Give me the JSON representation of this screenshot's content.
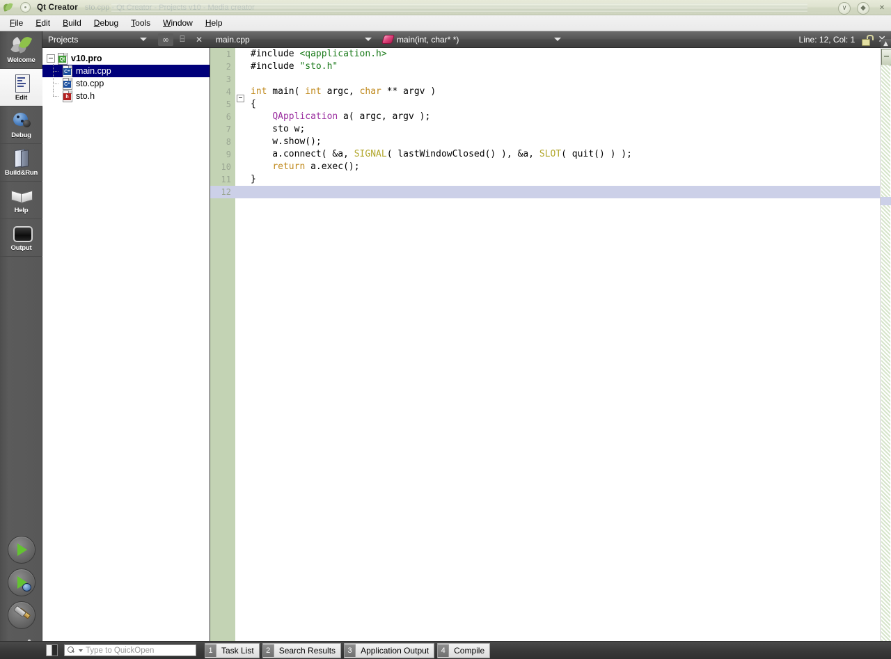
{
  "window": {
    "app_icon": "qt-leaf-icon",
    "title": "Qt Creator",
    "ghost_title": "sto.cpp - Qt Creator - Projects v10 - Media creator",
    "buttons": [
      {
        "name": "minimize",
        "glyph": "∨"
      },
      {
        "name": "maximize",
        "glyph": "◆"
      },
      {
        "name": "close",
        "glyph": "✕"
      }
    ]
  },
  "menubar": {
    "items": [
      {
        "name": "file",
        "accel": "F",
        "rest": "ile"
      },
      {
        "name": "edit",
        "accel": "E",
        "rest": "dit"
      },
      {
        "name": "build",
        "accel": "B",
        "rest": "uild"
      },
      {
        "name": "debug",
        "accel": "D",
        "rest": "ebug"
      },
      {
        "name": "tools",
        "accel": "T",
        "rest": "ools"
      },
      {
        "name": "window",
        "accel": "W",
        "rest": "indow"
      },
      {
        "name": "help",
        "accel": "H",
        "rest": "elp"
      }
    ]
  },
  "modebar": {
    "items": [
      {
        "label": "Welcome",
        "icon": "welcome-leaves-icon",
        "active": false
      },
      {
        "label": "Edit",
        "icon": "edit-document-icon",
        "active": true
      },
      {
        "label": "Debug",
        "icon": "debug-bug-icon",
        "active": false
      },
      {
        "label": "Build&Run",
        "icon": "build-book-icon",
        "active": false
      },
      {
        "label": "Help",
        "icon": "help-book-icon",
        "active": false
      },
      {
        "label": "Output",
        "icon": "output-screen-icon",
        "active": false
      }
    ],
    "run_buttons": [
      {
        "name": "run-button",
        "icon": "play-icon"
      },
      {
        "name": "debug-button",
        "icon": "play-with-bug-icon"
      },
      {
        "name": "build-button",
        "icon": "hammer-icon"
      }
    ]
  },
  "sidebar": {
    "title": "Projects",
    "header_icons": [
      {
        "name": "sync-link-icon",
        "glyph": "∞"
      },
      {
        "name": "split-view-icon",
        "glyph": "⌸"
      },
      {
        "name": "close-icon",
        "glyph": "✕"
      }
    ],
    "tree": [
      {
        "label": "v10.pro",
        "icon": "qt-project-icon",
        "badge": "Qt",
        "depth": 0,
        "selected": false,
        "bold": true,
        "expandable": true
      },
      {
        "label": "main.cpp",
        "icon": "cpp-file-icon",
        "badge": "C⁺",
        "depth": 1,
        "selected": true,
        "bold": false,
        "expandable": false
      },
      {
        "label": "sto.cpp",
        "icon": "cpp-file-icon",
        "badge": "C⁺",
        "depth": 1,
        "selected": false,
        "bold": false,
        "expandable": false
      },
      {
        "label": "sto.h",
        "icon": "header-file-icon",
        "badge": "h",
        "depth": 1,
        "selected": false,
        "bold": false,
        "expandable": false
      }
    ]
  },
  "editor": {
    "file_combo": "main.cpp",
    "symbol_combo": "main(int, char* *)",
    "symbol_icon": "function-symbol-icon",
    "cursor_status": "Line: 12, Col: 1",
    "lock_icon": "unlocked-icon",
    "close_icon": "close-icon",
    "current_line": 12,
    "lines": [
      {
        "num": 1,
        "fold": false,
        "tokens": [
          {
            "t": "#include ",
            "c": "t-pre"
          },
          {
            "t": "<qapplication.h>",
            "c": "t-inc"
          }
        ]
      },
      {
        "num": 2,
        "fold": false,
        "tokens": [
          {
            "t": "#include ",
            "c": "t-pre"
          },
          {
            "t": "\"sto.h\"",
            "c": "t-str"
          }
        ]
      },
      {
        "num": 3,
        "fold": false,
        "tokens": []
      },
      {
        "num": 4,
        "fold": true,
        "tokens": [
          {
            "t": "int",
            "c": "t-kw"
          },
          {
            "t": " main( ",
            "c": "t-plain"
          },
          {
            "t": "int",
            "c": "t-kw"
          },
          {
            "t": " argc, ",
            "c": "t-plain"
          },
          {
            "t": "char",
            "c": "t-kw"
          },
          {
            "t": " ** argv )",
            "c": "t-plain"
          }
        ]
      },
      {
        "num": 5,
        "fold": false,
        "tokens": [
          {
            "t": "{",
            "c": "t-plain"
          }
        ]
      },
      {
        "num": 6,
        "fold": false,
        "tokens": [
          {
            "t": "    ",
            "c": "t-plain"
          },
          {
            "t": "QApplication",
            "c": "t-cls"
          },
          {
            "t": " a( argc, argv );",
            "c": "t-plain"
          }
        ]
      },
      {
        "num": 7,
        "fold": false,
        "tokens": [
          {
            "t": "    sto w;",
            "c": "t-plain"
          }
        ]
      },
      {
        "num": 8,
        "fold": false,
        "tokens": [
          {
            "t": "    w.show();",
            "c": "t-plain"
          }
        ]
      },
      {
        "num": 9,
        "fold": false,
        "tokens": [
          {
            "t": "    a.connect( &a, ",
            "c": "t-plain"
          },
          {
            "t": "SIGNAL",
            "c": "t-macro"
          },
          {
            "t": "( lastWindowClosed() ), &a, ",
            "c": "t-plain"
          },
          {
            "t": "SLOT",
            "c": "t-macro"
          },
          {
            "t": "( quit() ) );",
            "c": "t-plain"
          }
        ]
      },
      {
        "num": 10,
        "fold": false,
        "tokens": [
          {
            "t": "    ",
            "c": "t-plain"
          },
          {
            "t": "return",
            "c": "t-kw"
          },
          {
            "t": " a.exec();",
            "c": "t-plain"
          }
        ]
      },
      {
        "num": 11,
        "fold": false,
        "tokens": [
          {
            "t": "}",
            "c": "t-plain"
          }
        ]
      },
      {
        "num": 12,
        "fold": false,
        "tokens": []
      }
    ]
  },
  "statusbar": {
    "toggle_icon": "sidebar-toggle-icon",
    "quickopen_placeholder": "Type to QuickOpen",
    "quickopen_value": "",
    "search_icon": "search-icon",
    "panels": [
      {
        "num": "1",
        "label": "Task List"
      },
      {
        "num": "2",
        "label": "Search Results"
      },
      {
        "num": "3",
        "label": "Application Output"
      },
      {
        "num": "4",
        "label": "Compile"
      }
    ]
  },
  "colors": {
    "selection_blue": "#00007a",
    "gutter_green": "#c3d3b4",
    "current_line": "#ccd0e8",
    "title_bg": "#dfe3d0",
    "toolbar_dark": "#4b4b4b"
  }
}
